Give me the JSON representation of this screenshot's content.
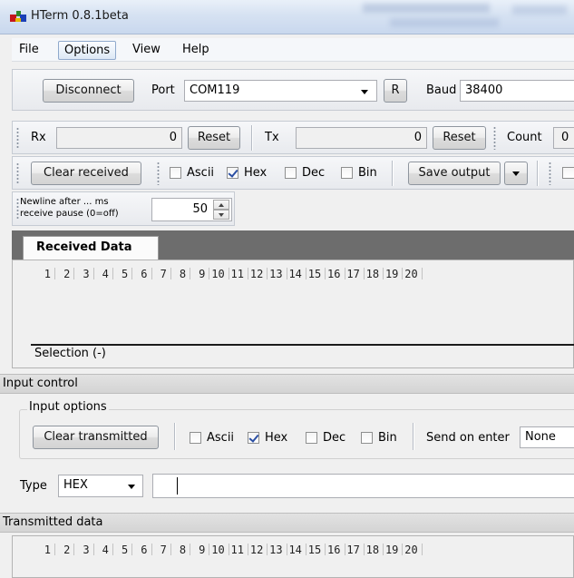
{
  "window": {
    "title": "HTerm 0.8.1beta"
  },
  "menu": {
    "items": [
      "File",
      "Options",
      "View",
      "Help"
    ],
    "active": "Options"
  },
  "connection": {
    "disconnect_label": "Disconnect",
    "port_label": "Port",
    "port_value": "COM119",
    "r_label": "R",
    "baud_label": "Baud",
    "baud_value": "38400"
  },
  "counters": {
    "rx_label": "Rx",
    "rx_value": "0",
    "rx_reset": "Reset",
    "tx_label": "Tx",
    "tx_value": "0",
    "tx_reset": "Reset",
    "count_label": "Count",
    "count_value": "0"
  },
  "receive_toolbar": {
    "clear_label": "Clear received",
    "ascii_label": "Ascii",
    "hex_label": "Hex",
    "dec_label": "Dec",
    "bin_label": "Bin",
    "ascii_checked": false,
    "hex_checked": true,
    "dec_checked": false,
    "bin_checked": false,
    "save_label": "Save output"
  },
  "newline": {
    "label_line1": "Newline after ... ms",
    "label_line2": "receive pause (0=off)",
    "value": "50"
  },
  "received": {
    "tab_label": "Received Data",
    "columns": [
      "1",
      "2",
      "3",
      "4",
      "5",
      "6",
      "7",
      "8",
      "9",
      "10",
      "11",
      "12",
      "13",
      "14",
      "15",
      "16",
      "17",
      "18",
      "19",
      "20"
    ],
    "selection_label": "Selection (-)"
  },
  "input_control": {
    "header": "Input control",
    "options_title": "Input options",
    "clear_label": "Clear transmitted",
    "ascii_label": "Ascii",
    "hex_label": "Hex",
    "dec_label": "Dec",
    "bin_label": "Bin",
    "send_on_enter_label": "Send on enter",
    "send_on_enter_value": "None",
    "type_label": "Type",
    "type_value": "HEX",
    "input_value": ""
  },
  "transmitted": {
    "header": "Transmitted data",
    "columns": [
      "1",
      "2",
      "3",
      "4",
      "5",
      "6",
      "7",
      "8",
      "9",
      "10",
      "11",
      "12",
      "13",
      "14",
      "15",
      "16",
      "17",
      "18",
      "19",
      "20"
    ]
  },
  "colors": {
    "tab_strip": "#6d6d6d",
    "title_gradient_top": "#e9f0f9",
    "title_gradient_bottom": "#c9d8ee",
    "check_mark": "#2b4fa3"
  }
}
